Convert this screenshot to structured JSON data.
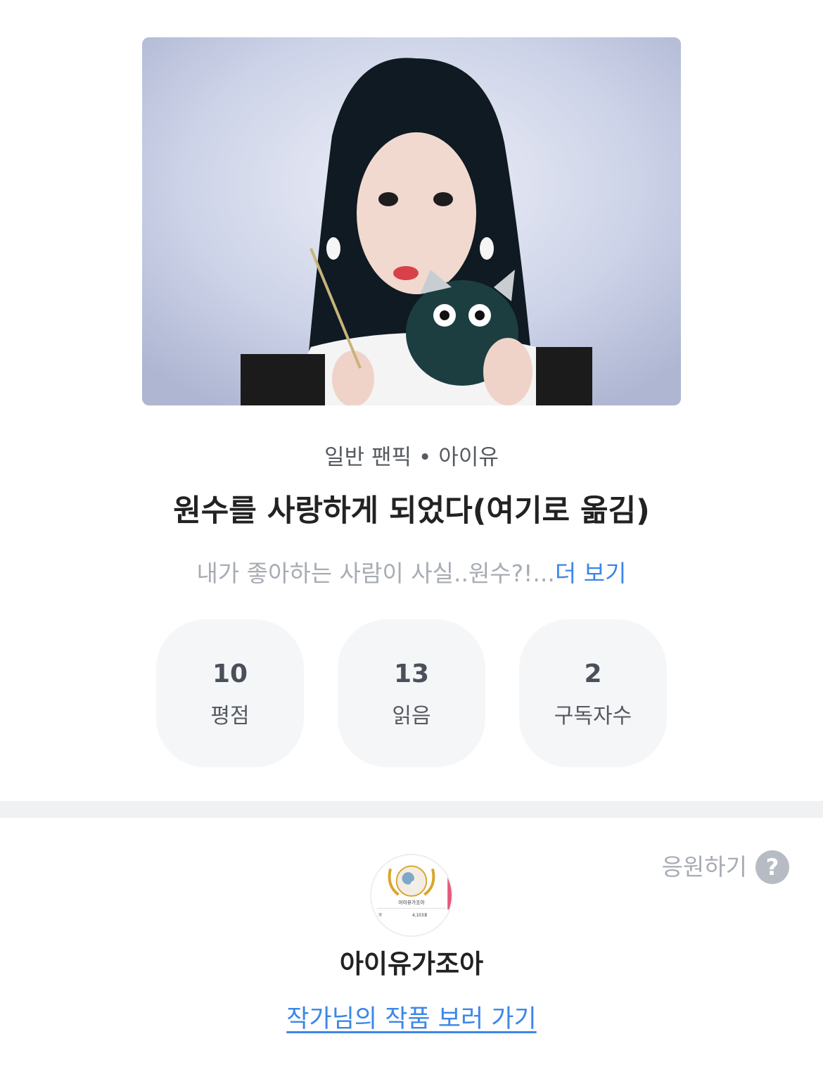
{
  "work": {
    "category": "일반 팬픽",
    "separator": "•",
    "tag": "아이유",
    "title": "원수를 사랑하게 되었다(여기로 옮김)",
    "synopsis": "내가 좋아하는 사람이 사실..원수?!...",
    "more_label": "더 보기"
  },
  "stats": [
    {
      "value": "10",
      "label": "평점"
    },
    {
      "value": "13",
      "label": "읽음"
    },
    {
      "value": "2",
      "label": "구독자수"
    }
  ],
  "author": {
    "name": "아이유가조아",
    "cheer_label": "응원하기",
    "help_glyph": "?",
    "works_link": "작가님의 작품 보러 가기",
    "avatar_text": {
      "name": "아이유가조아",
      "left_caption": "가",
      "right_value": "4,103표"
    }
  },
  "colors": {
    "accent_link": "#3b86e8",
    "muted_text": "#a7acb3",
    "stat_bg": "#f5f6f8",
    "divider": "#f0f1f3"
  }
}
